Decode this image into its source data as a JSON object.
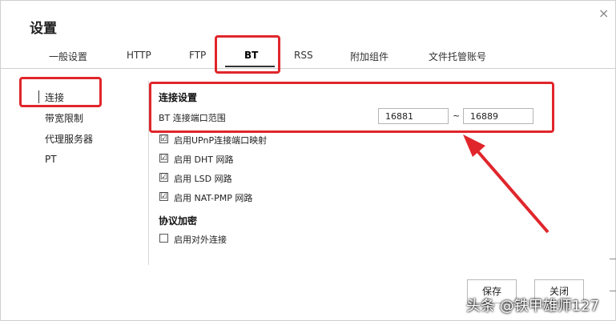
{
  "dialog": {
    "title": "设置",
    "close_glyph": "×"
  },
  "tabs": [
    {
      "label": "一般设置"
    },
    {
      "label": "HTTP"
    },
    {
      "label": "FTP"
    },
    {
      "label": "BT",
      "active": true
    },
    {
      "label": "RSS"
    },
    {
      "label": "附加组件"
    },
    {
      "label": "文件托管账号"
    }
  ],
  "sidebar": {
    "items": [
      {
        "label": "连接",
        "selected": true
      },
      {
        "label": "带宽限制"
      },
      {
        "label": "代理服务器"
      },
      {
        "label": "PT"
      }
    ]
  },
  "connection": {
    "section_title": "连接设置",
    "port_range_label": "BT 连接端口范围",
    "port_from": "16881",
    "port_separator": "~",
    "port_to": "16889",
    "options": [
      {
        "label": "启用UPnP连接端口映射",
        "checked": true
      },
      {
        "label": "启用 DHT 网路",
        "checked": true
      },
      {
        "label": "启用 LSD 网路",
        "checked": true
      },
      {
        "label": "启用 NAT-PMP 网路",
        "checked": true
      }
    ]
  },
  "encryption": {
    "section_title": "协议加密",
    "options": [
      {
        "label": "启用对外连接",
        "checked": false
      }
    ]
  },
  "buttons": {
    "save": "保存",
    "close": "关闭"
  },
  "watermark": "头条 @铁甲雄师127",
  "check_glyph": "☑",
  "colors": {
    "annotation_red": "#e0262b"
  }
}
